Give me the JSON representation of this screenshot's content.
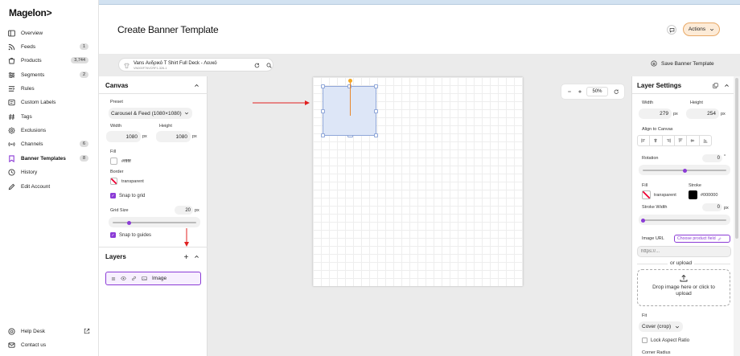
{
  "brand": {
    "logo": "Magelon>",
    "accent": "#8b3bd6"
  },
  "nav": {
    "items": [
      {
        "label": "Overview",
        "icon": "overview-icon",
        "badge": ""
      },
      {
        "label": "Feeds",
        "icon": "feeds-icon",
        "badge": "1"
      },
      {
        "label": "Products",
        "icon": "products-icon",
        "badge": "3,744"
      },
      {
        "label": "Segments",
        "icon": "segments-icon",
        "badge": "2"
      },
      {
        "label": "Rules",
        "icon": "rules-icon",
        "badge": ""
      },
      {
        "label": "Custom Labels",
        "icon": "custom-labels-icon",
        "badge": ""
      },
      {
        "label": "Tags",
        "icon": "tags-icon",
        "badge": ""
      },
      {
        "label": "Exclusions",
        "icon": "exclusions-icon",
        "badge": ""
      },
      {
        "label": "Channels",
        "icon": "channels-icon",
        "badge": "6"
      },
      {
        "label": "Banner Templates",
        "icon": "banner-templates-icon",
        "badge": "8"
      },
      {
        "label": "History",
        "icon": "history-icon",
        "badge": ""
      },
      {
        "label": "Edit Account",
        "icon": "edit-account-icon",
        "badge": ""
      }
    ],
    "footer": [
      {
        "label": "Help Desk",
        "icon": "help-icon"
      },
      {
        "label": "Contact us",
        "icon": "contact-icon"
      }
    ]
  },
  "header": {
    "title": "Create Banner Template",
    "actions_label": "Actions"
  },
  "toolbar": {
    "product_title": "Vans Ανδρικό T Shirt Full Deck - Λευκό",
    "product_sku": "VN000F76VCRF1-326-1",
    "save_label": "Save Banner Template"
  },
  "canvas_panel": {
    "title": "Canvas",
    "preset_label": "Preset",
    "preset_value": "Carousel & Feed (1080×1080)",
    "width_label": "Width",
    "width_value": "1080",
    "height_label": "Height",
    "height_value": "1080",
    "unit": "px",
    "fill_label": "Fill",
    "fill_value": "#ffffff",
    "border_label": "Border",
    "border_value": "transparent",
    "snap_grid_label": "Snap to grid",
    "grid_size_label": "Grid Size",
    "grid_size_value": "20",
    "grid_size_slider": 0.2,
    "snap_guides_label": "Snap to guides"
  },
  "layers": {
    "title": "Layers",
    "items": [
      {
        "name": "Image"
      }
    ]
  },
  "workspace": {
    "zoom": "50%"
  },
  "layer_settings": {
    "title": "Layer Settings",
    "width_label": "Width",
    "width_value": "279",
    "height_label": "Height",
    "height_value": "254",
    "unit": "px",
    "align_label": "Align to Canvas",
    "rotation_label": "Rotation",
    "rotation_value": "0",
    "rotation_unit": "°",
    "rotation_slider": 0.5,
    "fill_label": "Fill",
    "fill_value": "transparent",
    "stroke_label": "Stroke",
    "stroke_value": "#000000",
    "stroke_width_label": "Stroke Width",
    "stroke_width_value": "0",
    "stroke_width_slider": 0.0,
    "image_url_label": "Image URL",
    "choose_field_label": "Choose product field",
    "url_placeholder": "https://...",
    "or_upload": "or upload",
    "drop_text": "Drop image here or click to upload",
    "fit_label": "Fit",
    "fit_value": "Cover (crop)",
    "lock_aspect_label": "Lock Aspect Ratio",
    "corner_radius_label": "Corner Radius"
  }
}
